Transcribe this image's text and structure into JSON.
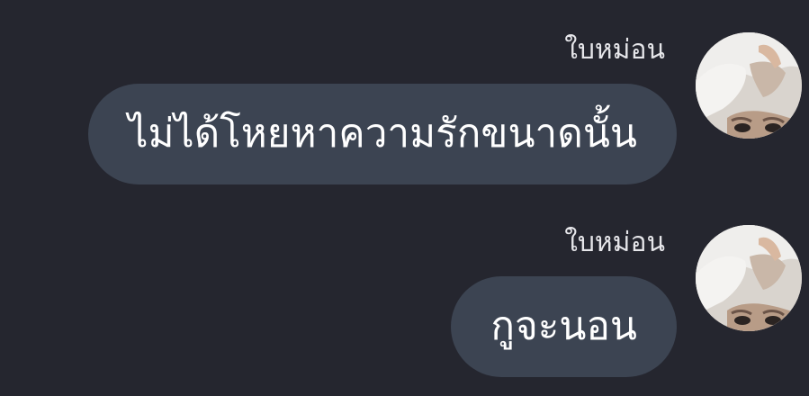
{
  "messages": [
    {
      "sender": "ใบหม่อน",
      "text": "ไม่ได้โหยหาความรักขนาดนั้น",
      "avatar_icon": "user-avatar-photo"
    },
    {
      "sender": "ใบหม่อน",
      "text": "กูจะนอน",
      "avatar_icon": "user-avatar-photo"
    }
  ],
  "colors": {
    "background": "#25262f",
    "bubble": "#3c4452",
    "message_text": "#ffffff",
    "sender_text": "#e6e6ea"
  }
}
